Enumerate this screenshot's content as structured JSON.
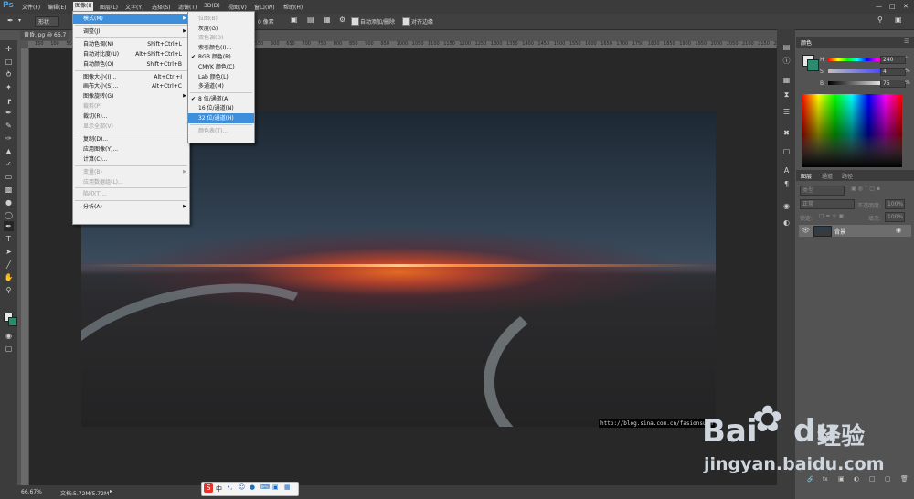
{
  "app": {
    "logo": "Ps"
  },
  "menubar": {
    "items": [
      "文件(F)",
      "编辑(E)",
      "图像(I)",
      "图层(L)",
      "文字(Y)",
      "选择(S)",
      "滤镜(T)",
      "3D(D)",
      "视图(V)",
      "窗口(W)",
      "帮助(H)"
    ]
  },
  "options_bar": {
    "style_label": "形状",
    "feather_value": "0 像素",
    "auto_add_delete_label": "自动添加/删除",
    "align_edges_label": "对齐边缘"
  },
  "document": {
    "tab_title": "黄昏.jpg @ 66.7"
  },
  "ruler": {
    "ticks": [
      "150",
      "100",
      "50",
      "0",
      "50",
      "100",
      "150",
      "200",
      "250",
      "300",
      "350",
      "400",
      "450",
      "500",
      "550",
      "600",
      "650",
      "700",
      "750",
      "800",
      "850",
      "900",
      "950",
      "1000",
      "1050",
      "1100",
      "1150",
      "1200",
      "1250",
      "1300",
      "1350",
      "1400",
      "1450",
      "1500",
      "1550",
      "1600",
      "1650",
      "1700",
      "1750",
      "1800",
      "1850",
      "1900",
      "1950",
      "2000",
      "2050",
      "2100",
      "2150",
      "2200"
    ]
  },
  "canvas": {
    "watermark_url": "http://blog.sina.com.cn/fasionsuan"
  },
  "status": {
    "zoom": "66.67%",
    "doc_size": "文档:5.72M/5.72M"
  },
  "image_menu": {
    "items": [
      {
        "label": "模式(M)",
        "shortcut": "",
        "submenu": true,
        "highlight": true,
        "disabled": false
      },
      {
        "sep": true
      },
      {
        "label": "调整(J)",
        "shortcut": "",
        "submenu": true,
        "disabled": false
      },
      {
        "sep": true
      },
      {
        "label": "自动色调(N)",
        "shortcut": "Shift+Ctrl+L",
        "disabled": false
      },
      {
        "label": "自动对比度(U)",
        "shortcut": "Alt+Shift+Ctrl+L",
        "disabled": false
      },
      {
        "label": "自动颜色(O)",
        "shortcut": "Shift+Ctrl+B",
        "disabled": false
      },
      {
        "sep": true
      },
      {
        "label": "图像大小(I)...",
        "shortcut": "Alt+Ctrl+I",
        "disabled": false
      },
      {
        "label": "画布大小(S)...",
        "shortcut": "Alt+Ctrl+C",
        "disabled": false
      },
      {
        "label": "图像旋转(G)",
        "shortcut": "",
        "submenu": true,
        "disabled": false
      },
      {
        "label": "裁剪(P)",
        "shortcut": "",
        "disabled": true
      },
      {
        "label": "裁切(R)...",
        "shortcut": "",
        "disabled": false
      },
      {
        "label": "显示全部(V)",
        "shortcut": "",
        "disabled": true
      },
      {
        "sep": true
      },
      {
        "label": "复制(D)...",
        "shortcut": "",
        "disabled": false
      },
      {
        "label": "应用图像(Y)...",
        "shortcut": "",
        "disabled": false
      },
      {
        "label": "计算(C)...",
        "shortcut": "",
        "disabled": false
      },
      {
        "sep": true
      },
      {
        "label": "变量(B)",
        "shortcut": "",
        "submenu": true,
        "disabled": true
      },
      {
        "label": "应用数据组(L)...",
        "shortcut": "",
        "disabled": true
      },
      {
        "sep": true
      },
      {
        "label": "陷印(T)...",
        "shortcut": "",
        "disabled": true
      },
      {
        "sep": true
      },
      {
        "label": "分析(A)",
        "shortcut": "",
        "submenu": true,
        "disabled": false
      }
    ]
  },
  "mode_submenu": {
    "items": [
      {
        "label": "位图(B)",
        "disabled": true
      },
      {
        "label": "灰度(G)",
        "disabled": false
      },
      {
        "label": "双色调(D)",
        "disabled": true
      },
      {
        "label": "索引颜色(I)...",
        "disabled": false
      },
      {
        "label": "RGB 颜色(R)",
        "checked": true,
        "disabled": false
      },
      {
        "label": "CMYK 颜色(C)",
        "disabled": false
      },
      {
        "label": "Lab 颜色(L)",
        "disabled": false
      },
      {
        "label": "多通道(M)",
        "disabled": false
      },
      {
        "sep": true
      },
      {
        "label": "8 位/通道(A)",
        "checked": true,
        "disabled": false
      },
      {
        "label": "16 位/通道(N)",
        "disabled": false
      },
      {
        "label": "32 位/通道(H)",
        "highlight": true,
        "disabled": false
      },
      {
        "sep": true
      },
      {
        "label": "颜色表(T)...",
        "disabled": true
      }
    ]
  },
  "color_panel": {
    "tab": "颜色",
    "sliders": [
      {
        "name": "H",
        "value": "240"
      },
      {
        "name": "S",
        "value": "4"
      },
      {
        "name": "B",
        "value": "75"
      }
    ],
    "units": [
      "°",
      "%",
      "%"
    ]
  },
  "layers_panel": {
    "tabs": [
      "图层",
      "通道",
      "路径"
    ],
    "kind_placeholder": "类型",
    "blend_mode": "正常",
    "opacity_label": "不透明度:",
    "opacity_value": "100%",
    "lock_label": "锁定:",
    "fill_label": "填充:",
    "fill_value": "100%",
    "layers": [
      {
        "name": "背景"
      }
    ]
  },
  "ime_bar": {
    "label": "中"
  },
  "watermark": {
    "brand": "Bai",
    "brand2": "du",
    "cn": "经验",
    "url": "jingyan.baidu.com"
  },
  "colors": {
    "menu_highlight": "#3d8edb",
    "panel_bg": "#535353",
    "app_bg": "#3c3c3c"
  }
}
